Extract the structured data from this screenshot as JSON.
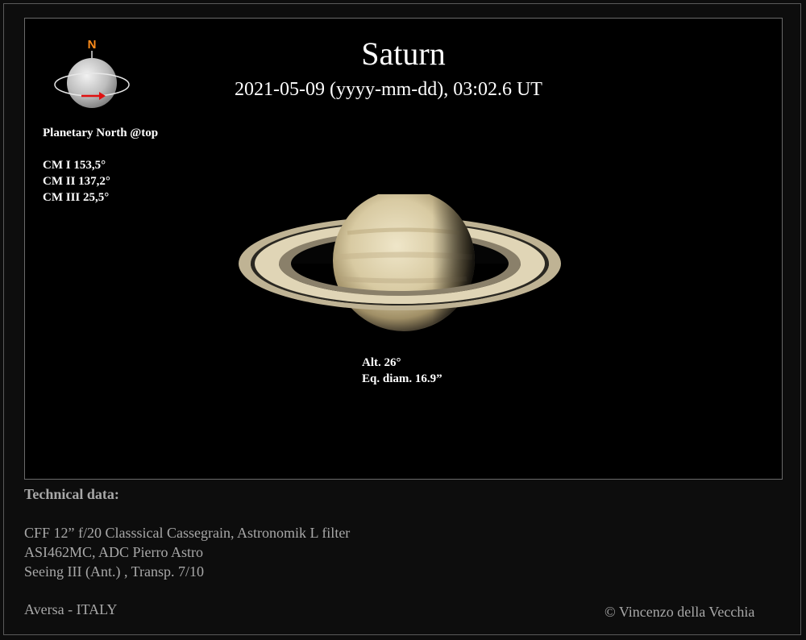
{
  "image": {
    "title": "Saturn",
    "datetime": "2021-05-09 (yyyy-mm-dd), 03:02.6 UT",
    "compass_label": "N",
    "orientation_note": "Planetary North  @top",
    "cm": [
      "CM I 153,5°",
      "CM II 137,2°",
      "CM III  25,5°"
    ],
    "altitude": "Alt. 26°",
    "diameter": "Eq. diam. 16.9”"
  },
  "footer": {
    "tech_title": "Technical data:",
    "telescope": "CFF 12” f/20 Classsical Cassegrain, Astronomik L filter",
    "camera": "ASI462MC, ADC Pierro Astro",
    "conditions": "Seeing III (Ant.) , Transp. 7/10",
    "location": "Aversa - ITALY",
    "credit": "© Vincenzo della Vecchia"
  },
  "colors": {
    "background": "#0d0d0d",
    "panel": "#000000",
    "compass_north": "#ff8c1a",
    "rotation_arrow": "#e01010",
    "footer_text": "#a8a8a8"
  }
}
